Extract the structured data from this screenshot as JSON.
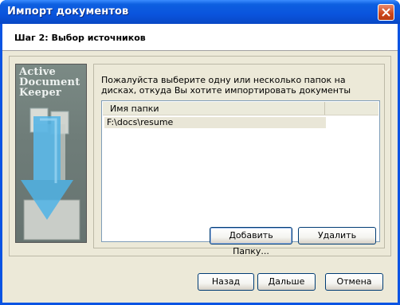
{
  "window": {
    "title": "Импорт документов"
  },
  "step": {
    "title": "Шаг 2: Выбор источников"
  },
  "banner": {
    "lines": [
      "Active",
      "Document",
      "Keeper"
    ]
  },
  "description": "Пожалуйста выберите одну или несколько папок на дисках, откуда Вы хотите импортировать документы",
  "folder_list": {
    "column_header": "Имя папки",
    "rows": [
      "F:\\docs\\resume"
    ]
  },
  "buttons": {
    "add_folder": "Добавить Папку...",
    "delete": "Удалить",
    "back": "Назад",
    "next": "Дальше",
    "cancel": "Отмена"
  },
  "colors": {
    "titlebar": "#0a54e3",
    "dialog_bg": "#ece9d8",
    "close_button": "#cc4519"
  },
  "icons": {
    "close": "close-icon",
    "banner_arrow": "down-arrow-icon"
  }
}
